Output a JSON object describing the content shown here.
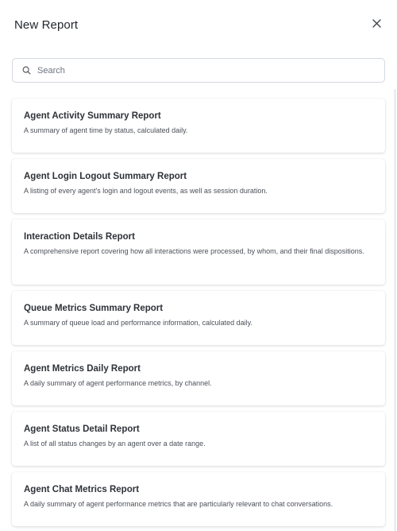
{
  "dialog": {
    "title": "New Report"
  },
  "search": {
    "placeholder": "Search",
    "value": ""
  },
  "reports": [
    {
      "title": "Agent Activity Summary Report",
      "description": "A summary of agent time by status, calculated daily."
    },
    {
      "title": "Agent Login Logout Summary Report",
      "description": "A listing of every agent's login and logout events, as well as session duration."
    },
    {
      "title": "Interaction Details Report",
      "description": "A comprehensive report covering how all interactions were processed, by whom, and their final dispositions."
    },
    {
      "title": "Queue Metrics Summary Report",
      "description": "A summary of queue load and performance information, calculated daily."
    },
    {
      "title": "Agent Metrics Daily Report",
      "description": "A daily summary of agent performance metrics, by channel."
    },
    {
      "title": "Agent Status Detail Report",
      "description": "A list of all status changes by an agent over a date range."
    },
    {
      "title": "Agent Chat Metrics Report",
      "description": "A daily summary of agent performance metrics that are particularly relevant to chat conversations."
    }
  ]
}
